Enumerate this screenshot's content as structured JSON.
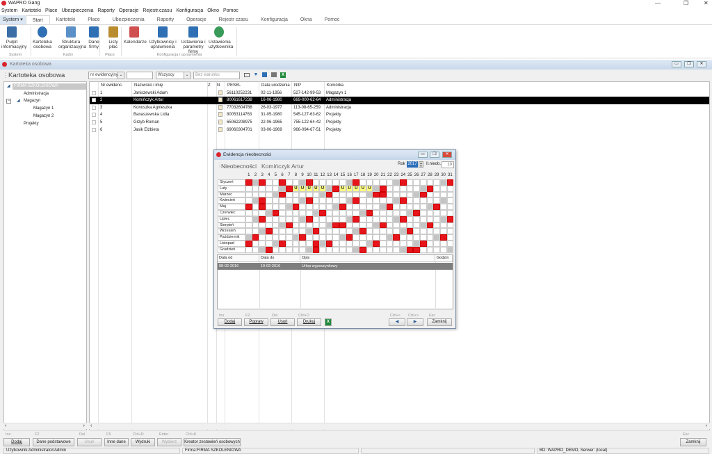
{
  "app": {
    "title": "WAPRO Gang"
  },
  "menu": [
    "System",
    "Kartoteki",
    "Płace",
    "Ubezpieczenia",
    "Raporty",
    "Operacje",
    "Rejestr.czasu",
    "Konfiguracja",
    "Okno",
    "Pomoc"
  ],
  "tabs": [
    "System ▾",
    "Start",
    "Kartoteki",
    "Płace",
    "Ubezpieczenia",
    "Raporty",
    "Operacje",
    "Rejestr czasu",
    "Konfiguracja",
    "Okna",
    "Pomoc"
  ],
  "ribbon": {
    "buttons": [
      {
        "l1": "Pulpit",
        "l2": "informacyjny",
        "icon": "dashboard-icon",
        "color": "#3b6ea5"
      },
      {
        "l1": "Kartoteka",
        "l2": "osobowa",
        "icon": "people-icon",
        "color": "#2f6fb3"
      },
      {
        "l1": "Struktura",
        "l2": "organizacyjna",
        "icon": "org-chart-icon",
        "color": "#5a8fc8"
      },
      {
        "l1": "Dane",
        "l2": "firmy",
        "icon": "building-icon",
        "color": "#2f6fb3"
      },
      {
        "l1": "Listy",
        "l2": "płac",
        "icon": "payroll-list-icon",
        "color": "#b98d2e"
      },
      {
        "l1": "Kalendarze",
        "l2": "",
        "icon": "calendar-icon",
        "color": "#d05050"
      },
      {
        "l1": "Użytkownicy i",
        "l2": "uprawnienia",
        "icon": "shield-user-icon",
        "color": "#2f6fb3"
      },
      {
        "l1": "Ustawienia i",
        "l2": "parametry firmy",
        "icon": "settings-company-icon",
        "color": "#2f6fb3"
      },
      {
        "l1": "Ustawienia",
        "l2": "użytkownika",
        "icon": "settings-user-icon",
        "color": "#3a9a5a"
      }
    ],
    "groups": [
      "System",
      "Kadry",
      "Płace",
      "Konfiguracja i uprawnienia"
    ]
  },
  "window": {
    "title": "Kartoteka osobowa",
    "heading": "Kartoteka osobowa"
  },
  "filters": {
    "sort": "nr ewidencyjny",
    "search": "",
    "scope": "Wszyscy",
    "condition": "Bez warunku"
  },
  "tree": [
    {
      "label": "FIRMA SZKOLENIOWA",
      "level": 0
    },
    {
      "label": "Administracja",
      "level": 1
    },
    {
      "label": "Magazyn",
      "level": 1
    },
    {
      "label": "Magazyn 1",
      "level": 2
    },
    {
      "label": "Magazyn 2",
      "level": 2
    },
    {
      "label": "Projekty",
      "level": 1
    }
  ],
  "grid": {
    "columns": [
      "Nr ewidenc.",
      "Nazwisko i imię",
      "Z",
      "N",
      "PESEL",
      "Data urodzenia",
      "NIP",
      "Komórka"
    ],
    "rows": [
      {
        "nr": "1",
        "name": "Janiszewski Adam",
        "pesel": "56110252231",
        "dob": "02-11-1956",
        "nip": "527-142-99-53",
        "unit": "Magazyn 1"
      },
      {
        "nr": "2",
        "name": "Komińczyk Artur",
        "pesel": "80061617238",
        "dob": "16-06-1980",
        "nip": "669-000-62-64",
        "unit": "Administracja"
      },
      {
        "nr": "3",
        "name": "Konoszka Agnieszka",
        "pesel": "77032604788",
        "dob": "26-03-1977",
        "nip": "113-08-65-259",
        "unit": "Administracja"
      },
      {
        "nr": "4",
        "name": "Banaszewska Lidia",
        "pesel": "80053114763",
        "dob": "31-05-1980",
        "nip": "545-127-63-62",
        "unit": "Projekty"
      },
      {
        "nr": "5",
        "name": "Grzyb Roman",
        "pesel": "65062208975",
        "dob": "22-06-1965",
        "nip": "755-122-64-42",
        "unit": "Projekty"
      },
      {
        "nr": "6",
        "name": "Jasik Elżbieta",
        "pesel": "69060304701",
        "dob": "03-06-1969",
        "nip": "966-094-67-51",
        "unit": "Projekty"
      }
    ]
  },
  "actions": [
    {
      "key": "Ins",
      "label": "Dodaj",
      "enabled": true
    },
    {
      "key": "F2",
      "label": "Dane podstawowe",
      "enabled": true
    },
    {
      "key": "Del",
      "label": "Usuń",
      "enabled": false
    },
    {
      "key": "F5",
      "label": "Inne dane",
      "enabled": true
    },
    {
      "key": "Ctrl+D",
      "label": "Wydruki",
      "enabled": true
    },
    {
      "key": "Enter",
      "label": "Wybierz",
      "enabled": false
    },
    {
      "key": "Ctrl+K",
      "label": "Kreator zestawień osobowych",
      "enabled": true
    }
  ],
  "close_action": {
    "key": "Esc",
    "label": "Zamknij"
  },
  "status": {
    "user": "Użytkownik:Administrator/Admin",
    "firm": "Firma:FIRMA SZKOLENIOWA",
    "db": "BD: WAPRO_DEMO, Serwer: (local)"
  },
  "dialog": {
    "title": "Ewidencja nieobecności",
    "heading": "Nieobecności",
    "employee": "Komińczyk Artur",
    "year_label": "Rok",
    "year": "2017",
    "count_label": "Il.nieob.",
    "count": "10",
    "absence_mark": "U",
    "months": [
      {
        "name": "Styczeń",
        "days": "rgr..r..gr.....gr.....gr.....gr"
      },
      {
        "name": "Luty",
        "days": ".....gruuuuugruuuuugr.....gr.--"
      },
      {
        "name": "Marzec",
        "days": "....gr.....gr.....grr....gr...."
      },
      {
        "name": "Kwiecień",
        "days": ".gr.....gr.....gr.....gr.....g-"
      },
      {
        "name": "Maj",
        "days": "r.r...gr.....gr.....gr.....gr.."
      },
      {
        "name": "Czerwiec",
        "days": "...gr.....gr.....gr.....gr....-"
      },
      {
        "name": "Lipiec",
        "days": ".gr.....gr.....gr.....gr.....gr"
      },
      {
        "name": "Sierpień",
        "days": ".....gr.....grr....gr.....gr..."
      },
      {
        "name": "Wrzesień",
        "days": "..gr.....gr.....gr.....gr.....-"
      },
      {
        "name": "Październik",
        "days": "gr.....gr.....gr.....gr.....gr."
      },
      {
        "name": "Listopad",
        "days": "r...gr....rgr.....gr.....gr...-"
      },
      {
        "name": "Grudzień",
        "days": "..gr.....gr.....gr.....grr....g"
      }
    ],
    "colors": {
      "holiday": "#e8141b",
      "saturday": "#c4c4c4",
      "absence": "#ffff80"
    },
    "list_columns": [
      "Data od",
      "Data do",
      "Opis",
      "Godzin"
    ],
    "list_rows": [
      {
        "from": "08-02-2016",
        "to": "19-02-2016",
        "desc": "Urlop wypoczynkowy",
        "hours": ""
      }
    ],
    "buttons": [
      {
        "key": "Ins",
        "label": "Dodaj"
      },
      {
        "key": "F2",
        "label": "Popraw"
      },
      {
        "key": "Del",
        "label": "Usuń"
      },
      {
        "key": "Ctrl+D",
        "label": "Drukuj"
      }
    ],
    "nav": [
      {
        "key": "Ctrl+<",
        "label": "◀"
      },
      {
        "key": "Ctrl+>",
        "label": "▶"
      }
    ],
    "close": {
      "key": "Esc",
      "label": "Zamknij"
    }
  }
}
